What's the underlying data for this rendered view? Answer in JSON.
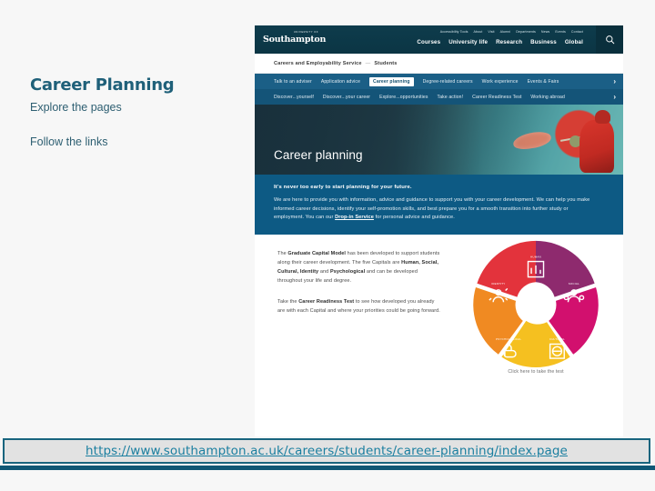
{
  "slide": {
    "title": "Career Planning",
    "subtitle": "Explore the pages",
    "secondary": "Follow the links",
    "accent_color": "#1f6079"
  },
  "url_bar": {
    "url": "https://www.southampton.ac.uk/careers/students/career-planning/index.page",
    "link_color": "#1b7fa0",
    "border_color": "#18647e"
  },
  "screenshot": {
    "header": {
      "logo_kicker": "UNIVERSITY OF",
      "logo_name": "Southampton",
      "utility_links": [
        "Accessibility Tools",
        "About",
        "Visit",
        "Alumni",
        "Departments",
        "News",
        "Events",
        "Contact"
      ],
      "main_links": [
        "Courses",
        "University life",
        "Research",
        "Business",
        "Global"
      ],
      "search_icon": "search-icon",
      "background_color": "#0d3b4a"
    },
    "breadcrumb": {
      "parent": "Careers and Employability Service",
      "separator": "—",
      "current": "Students"
    },
    "subnav_primary": {
      "items": [
        "Talk to an adviser",
        "Application advice",
        "Career planning",
        "Degree-related careers",
        "Work experience",
        "Events & Fairs"
      ],
      "active": "Career planning",
      "overflow_icon": "chevron-right-icon",
      "background_color": "#1b5f86"
    },
    "subnav_secondary": {
      "items": [
        "Discover...yourself",
        "Discover...your career",
        "Explore...opportunities",
        "Take action!",
        "Career Readiness Test",
        "Working abroad"
      ],
      "overflow_icon": "chevron-right-icon",
      "background_color": "#145478"
    },
    "hero": {
      "title": "Career planning",
      "image_alt": "kayaker-paddling"
    },
    "intro": {
      "lead": "It's never too early to start planning for your future.",
      "body_part1": "We are here to provide you with information, advice and guidance to support you with your career development. We can help you make informed career decisions, identify your self-promotion skills, and best prepare you for a smooth transition into further study or employment. You can our ",
      "link_text": "Drop-in Service",
      "body_part2": " for personal advice and guidance.",
      "background_color": "#0d5a84"
    },
    "capital_model": {
      "paragraph1_a": "The ",
      "paragraph1_b": "Graduate Capital Model",
      "paragraph1_c": " has been developed to support students along their career development. The five Capitals are ",
      "paragraph1_d": "Human, Social, Cultural, Identity",
      "paragraph1_e": " and ",
      "paragraph1_f": "Psychological",
      "paragraph1_g": " and can be developed throughout your life and degree.",
      "paragraph2_a": "Take the ",
      "paragraph2_b": "Career Readiness Test",
      "paragraph2_c": " to see how developed you already are with each Capital and where your priorities could be going forward.",
      "caption": "Click here to take the test"
    },
    "wheel": {
      "segments": [
        {
          "label": "HUMAN",
          "color": "#8e2a6e",
          "icon": "chart-icon"
        },
        {
          "label": "SOCIAL",
          "color": "#d2106e",
          "icon": "people-icon"
        },
        {
          "label": "CULTURAL",
          "color": "#f5c020",
          "icon": "globe-icon"
        },
        {
          "label": "PSYCHOLOGICAL",
          "color": "#f08a22",
          "icon": "fist-icon"
        },
        {
          "label": "IDENTITY",
          "color": "#e3333c",
          "icon": "person-star-icon"
        }
      ]
    }
  }
}
